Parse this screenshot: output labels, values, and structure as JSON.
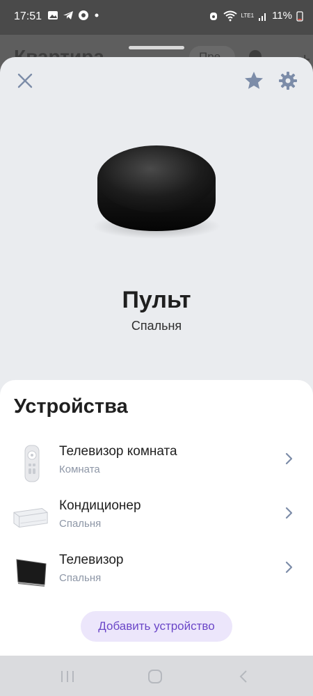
{
  "status_bar": {
    "time": "17:51",
    "battery_text": "11%",
    "network_label": "LTE1",
    "icons": [
      "gallery-icon",
      "telegram-icon",
      "record-icon",
      "dot-icon",
      "alarm-icon",
      "wifi-icon",
      "signal-icon",
      "battery-icon"
    ]
  },
  "background_app": {
    "title": "Квартира",
    "chip": "Пре"
  },
  "header": {
    "close_icon": "close-icon",
    "favorite_icon": "star-icon",
    "settings_icon": "gear-icon"
  },
  "device": {
    "name": "Пульт",
    "room": "Спальня"
  },
  "devices_section": {
    "title": "Устройства",
    "items": [
      {
        "name": "Телевизор комната",
        "room": "Комната",
        "icon": "tv-remote-icon"
      },
      {
        "name": "Кондиционер",
        "room": "Спальня",
        "icon": "air-conditioner-icon"
      },
      {
        "name": "Телевизор",
        "room": "Спальня",
        "icon": "tv-icon"
      }
    ],
    "add_button": "Добавить устройство"
  },
  "colors": {
    "accent": "#6b47c8",
    "accent_bg": "#ece6fb",
    "sheet_bg": "#eaecef",
    "panel_bg": "#ffffff",
    "muted_text": "#8d96a6"
  }
}
